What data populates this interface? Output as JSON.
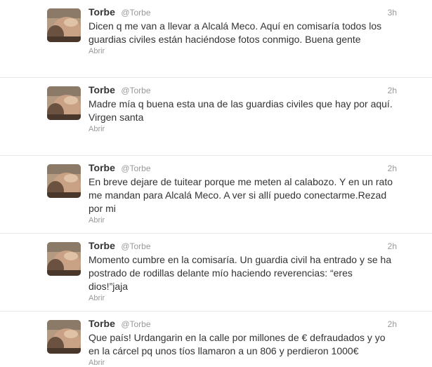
{
  "tweets": [
    {
      "name": "Torbe",
      "handle": "@Torbe",
      "time": "3h",
      "text": "Dicen q me van a llevar a Alcalá Meco. Aquí en comisaría todos los guardias civiles están haciéndose fotos conmigo. Buena gente",
      "open_label": "Abrir"
    },
    {
      "name": "Torbe",
      "handle": "@Torbe",
      "time": "2h",
      "text": "Madre mía q buena esta una de las guardias civiles que hay por aquí. Virgen santa",
      "open_label": "Abrir"
    },
    {
      "name": "Torbe",
      "handle": "@Torbe",
      "time": "2h",
      "text": "En breve dejare de tuitear porque me meten al calabozo. Y en un rato me mandan para Alcalá Meco. A ver si allí puedo conectarme.Rezad por mi",
      "open_label": "Abrir"
    },
    {
      "name": "Torbe",
      "handle": "@Torbe",
      "time": "2h",
      "text": "Momento cumbre en la comisaría. Un guardia civil ha entrado y se ha postrado de rodillas delante mío haciendo reverencias: “eres dios!”jaja",
      "open_label": "Abrir"
    },
    {
      "name": "Torbe",
      "handle": "@Torbe",
      "time": "2h",
      "text": "Que país! Urdangarin en la calle por millones de € defraudados y yo en la cárcel pq unos tíos llamaron a un 806 y perdieron 1000€",
      "open_label": "Abrir"
    }
  ]
}
